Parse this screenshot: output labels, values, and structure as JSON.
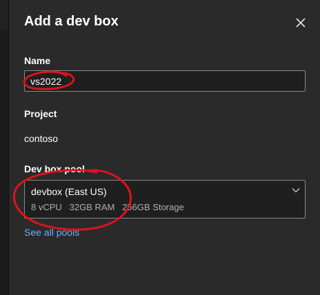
{
  "dialog": {
    "title": "Add a dev box",
    "close_icon": "close-icon"
  },
  "name_field": {
    "label": "Name",
    "value": "vs2022"
  },
  "project": {
    "label": "Project",
    "value": "contoso"
  },
  "pool": {
    "label": "Dev box pool",
    "selected_name": "devbox (East US)",
    "specs": "8 vCPU   32GB RAM   256GB Storage",
    "dropdown_icon": "chevron-down-icon"
  },
  "see_all_link": "See all pools",
  "colors": {
    "panel_bg": "#2a2a2a",
    "input_bg": "#1f1f1f",
    "link": "#6bb0ff",
    "annotation": "#e0121c"
  }
}
